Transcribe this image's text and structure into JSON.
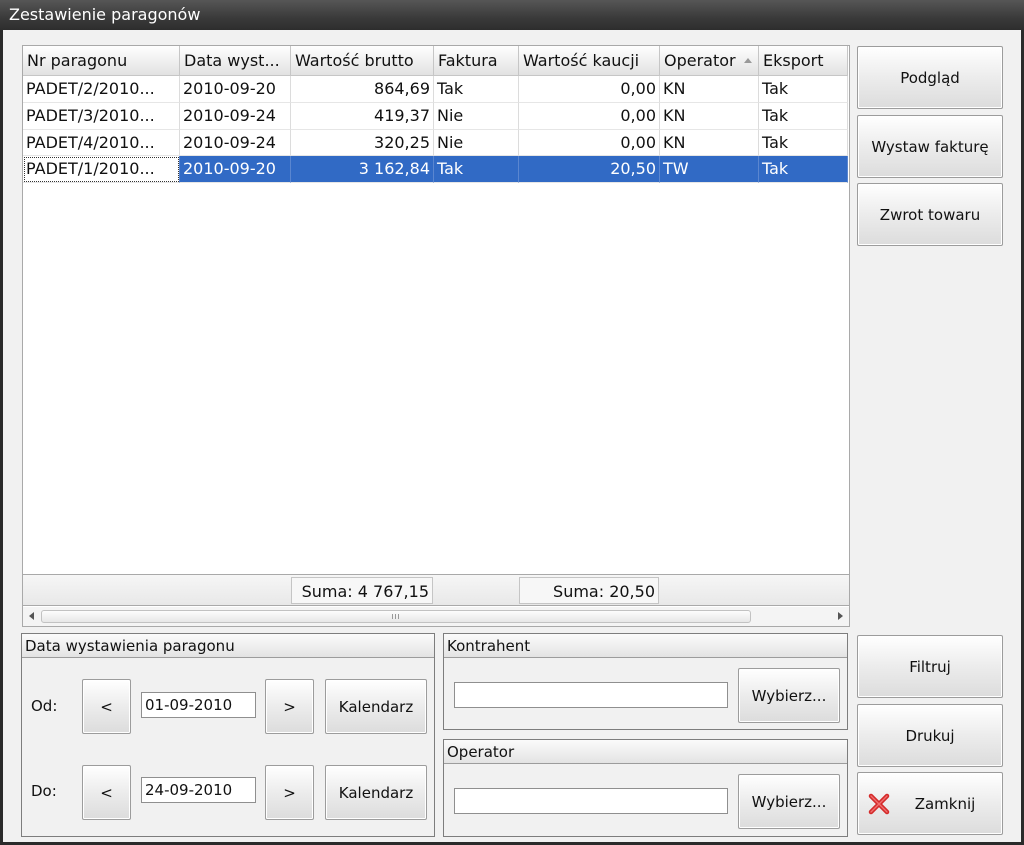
{
  "window": {
    "title": "Zestawienie paragonów"
  },
  "grid": {
    "columns": [
      "Nr paragonu",
      "Data wyst...",
      "Wartość brutto",
      "Faktura",
      "Wartość kaucji",
      "Operator",
      "Eksport"
    ],
    "rows": [
      [
        "PADET/2/2010...",
        "2010-09-20",
        "864,69",
        "Tak",
        "0,00",
        "KN",
        "Tak"
      ],
      [
        "PADET/3/2010...",
        "2010-09-24",
        "419,37",
        "Nie",
        "0,00",
        "KN",
        "Tak"
      ],
      [
        "PADET/4/2010...",
        "2010-09-24",
        "320,25",
        "Nie",
        "0,00",
        "KN",
        "Tak"
      ],
      [
        "PADET/1/2010...",
        "2010-09-20",
        "3 162,84",
        "Tak",
        "20,50",
        "TW",
        "Tak"
      ]
    ],
    "selected_row": 3,
    "sums": {
      "brutto": "Suma: 4 767,15",
      "kaucja": "Suma: 20,50"
    }
  },
  "actions": {
    "preview": "Podgląd",
    "invoice": "Wystaw fakturę",
    "return": "Zwrot towaru",
    "filter": "Filtruj",
    "print": "Drukuj",
    "close": "Zamknij"
  },
  "date_group": {
    "title": "Data wystawienia paragonu",
    "from_label": "Od:",
    "to_label": "Do:",
    "prev": "<",
    "next": ">",
    "calendar": "Kalendarz",
    "from_value": "01-09-2010",
    "to_value": "24-09-2010"
  },
  "contractor_group": {
    "title": "Kontrahent",
    "value": "",
    "choose": "Wybierz..."
  },
  "operator_group": {
    "title": "Operator",
    "value": "",
    "choose": "Wybierz..."
  },
  "colors": {
    "selection": "#316ac5",
    "close_icon": "#d42a2a"
  },
  "icons": {
    "close": "close-x-icon",
    "sort": "sort-ascending-icon"
  }
}
